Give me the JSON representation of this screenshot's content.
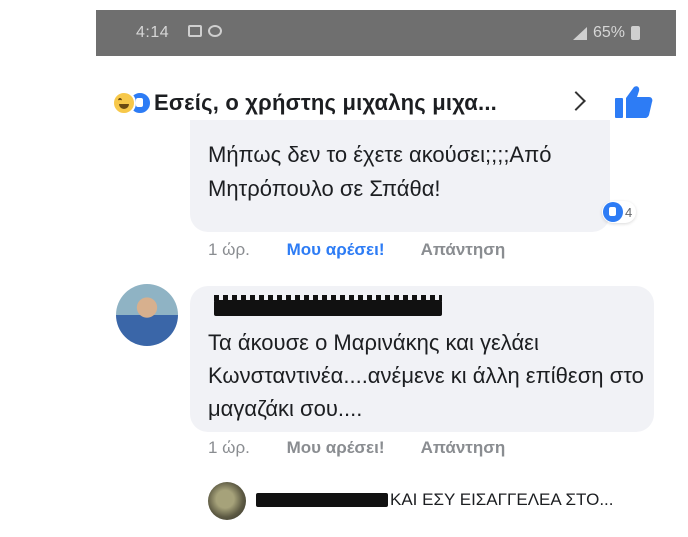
{
  "status_bar": {
    "time": "4:14",
    "battery": "65%"
  },
  "reactions_header": {
    "title": "Εσείς, ο χρήστης μιχαλης μιχα..."
  },
  "comments": [
    {
      "text": "Μήπως δεν το έχετε ακούσει;;;;Από Μητρόπουλο σε Σπάθα!",
      "reaction_count": "4",
      "time": "1 ώρ.",
      "like_label": "Μου αρέσει!",
      "reply_label": "Απάντηση",
      "liked": true
    },
    {
      "text": "Τα άκουσε ο Μαρινάκης και γελάει Κωνσταντινέα....ανέμενε κι άλλη επίθεση στο μαγαζάκι σου....",
      "time": "1 ώρ.",
      "like_label": "Μου αρέσει!",
      "reply_label": "Απάντηση",
      "liked": false
    }
  ],
  "reply_preview": {
    "text": "ΚΑΙ ΕΣΥ ΕΙΣΑΓΓΕΛΕΑ ΣΤΟ..."
  },
  "colors": {
    "accent": "#2d7cf5",
    "bubble": "#f1f2f6",
    "status_bar": "#6f6f6f"
  }
}
